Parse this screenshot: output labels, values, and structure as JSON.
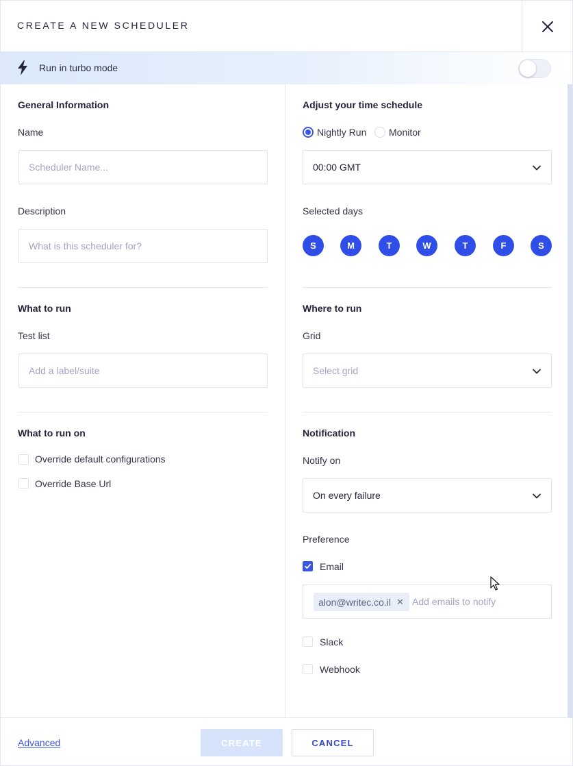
{
  "header": {
    "title": "CREATE A NEW SCHEDULER",
    "close_icon": "close-icon"
  },
  "turbo": {
    "icon": "lightning-icon",
    "label": "Run in turbo mode",
    "enabled": false
  },
  "general": {
    "title": "General Information",
    "name_label": "Name",
    "name_placeholder": "Scheduler Name...",
    "description_label": "Description",
    "description_placeholder": "What is this scheduler for?"
  },
  "schedule": {
    "title": "Adjust your time schedule",
    "options": [
      {
        "label": "Nightly Run",
        "selected": true
      },
      {
        "label": "Monitor",
        "selected": false
      }
    ],
    "time_value": "00:00 GMT",
    "days_label": "Selected days",
    "days": [
      "S",
      "M",
      "T",
      "W",
      "T",
      "F",
      "S"
    ],
    "days_selected": [
      true,
      true,
      true,
      true,
      true,
      true,
      true
    ]
  },
  "what_to_run": {
    "title": "What to run",
    "test_list_label": "Test list",
    "test_list_placeholder": "Add a label/suite"
  },
  "where_to_run": {
    "title": "Where to run",
    "grid_label": "Grid",
    "grid_placeholder": "Select grid"
  },
  "what_to_run_on": {
    "title": "What to run on",
    "options": [
      {
        "label": "Override default configurations",
        "checked": false
      },
      {
        "label": "Override Base Url",
        "checked": false
      }
    ]
  },
  "notification": {
    "title": "Notification",
    "notify_on_label": "Notify on",
    "notify_on_value": "On every failure",
    "preference_label": "Preference",
    "email_label": "Email",
    "email_checked": true,
    "emails": [
      "alon@writec.co.il"
    ],
    "email_placeholder": "Add emails to notify",
    "slack_label": "Slack",
    "slack_checked": false,
    "webhook_label": "Webhook",
    "webhook_checked": false
  },
  "footer": {
    "advanced_label": "Advanced",
    "create_label": "CREATE",
    "cancel_label": "CANCEL"
  },
  "colors": {
    "accent": "#3a55e8",
    "day_circle": "#2f4ee8",
    "create_disabled": "#d7e3fa",
    "cancel_text": "#3448c8"
  }
}
